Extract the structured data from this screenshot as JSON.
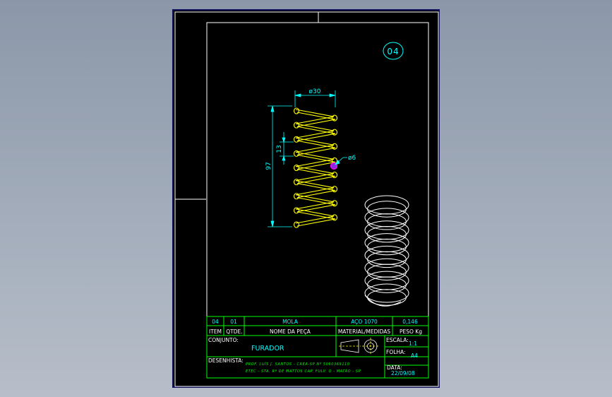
{
  "part_balloon": "04",
  "dimensions": {
    "diameter_outer": "ø30",
    "length": "97",
    "pitch": "13",
    "wire_diameter": "ø6"
  },
  "title_block": {
    "row1": {
      "item": "04",
      "qty": "01",
      "name": "MOLA",
      "material": "AÇO 1070",
      "weight": "0,146"
    },
    "header": {
      "item": "ITEM",
      "qty": "QTDE.",
      "name": "NOME DA PEÇA",
      "material": "MATERIAL/MEDIDAS",
      "weight": "PESO Kg"
    },
    "conjunto_label": "CONJUNTO:",
    "conjunto_value": "FURADOR",
    "escala_label": "ESCALA:",
    "escala_value": "1:1",
    "folha_label": "FOLHA:",
    "folha_value": "A4",
    "desenhista_label": "DESENHISTA:",
    "desenhista_line1": "PROF. LUÍS J. SANTOS - CREA-SP Nº 5060369110",
    "desenhista_line2": "ETEC - STA. Rª DE MATTOS CAP. FULV. O - MATÃO - SP",
    "data_label": "DATA:",
    "data_value": "22/09/08"
  },
  "colors": {
    "background": "#000000",
    "border": "#ffffff",
    "spring_2d": "#ffff00",
    "dimension": "#00ffff",
    "title_block": "#00ff00",
    "title_text": "#00ffff",
    "spring_3d": "#ffffff",
    "wire_section": "#ff00ff"
  }
}
